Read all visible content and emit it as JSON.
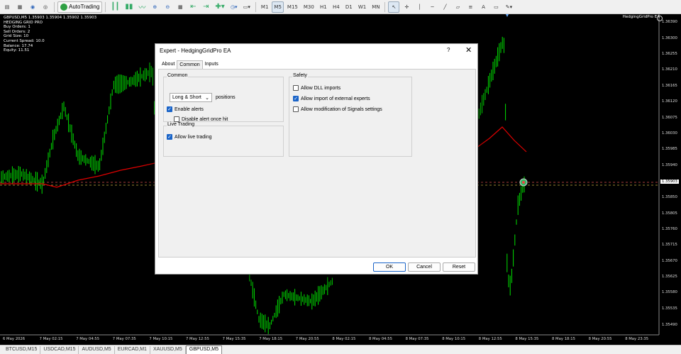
{
  "toolbar": {
    "autotrading_label": "AutoTrading",
    "timeframes": [
      "M1",
      "M5",
      "M15",
      "M30",
      "H1",
      "H4",
      "D1",
      "W1",
      "MN"
    ],
    "active_timeframe": "M5"
  },
  "chart": {
    "header": "GBPUSD,M5  1.35903 1.35904 1.35902 1.35903",
    "ea_name": "HedgingGridPro EA",
    "info_lines": [
      "HEDGING GRID PRO",
      "Buy Orders: 1",
      "Sell Orders: 2",
      "Grid Size: 10",
      "Current Spread: 10.0",
      "Balance: 17.74",
      "Equity: 11.51"
    ],
    "current_price": "1.35903",
    "price_labels": [
      "1.36390",
      "1.36300",
      "1.36255",
      "1.36210",
      "1.36165",
      "1.36120",
      "1.36075",
      "1.36030",
      "1.35985",
      "1.35940",
      "1.35850",
      "1.35805",
      "1.35760",
      "1.35715",
      "1.35670",
      "1.35625",
      "1.35580",
      "1.35535",
      "1.35490"
    ],
    "time_labels": [
      "6 May 2026",
      "7 May 02:15",
      "7 May 04:55",
      "7 May 07:35",
      "7 May 10:15",
      "7 May 12:55",
      "7 May 15:35",
      "7 May 18:15",
      "7 May 20:55",
      "8 May 02:15",
      "8 May 04:55",
      "8 May 07:35",
      "8 May 10:15",
      "8 May 12:55",
      "8 May 15:35",
      "8 May 18:15",
      "8 May 20:55",
      "8 May 23:35"
    ],
    "colors": {
      "candle": "#00e000",
      "ma": "#e00000",
      "level": "#e05050"
    }
  },
  "tabs": [
    "BTCUSD,M15",
    "USDCAD,M15",
    "AUDUSD,M5",
    "EURCAD,M1",
    "XAUUSD,M5",
    "GBPUSD,M5"
  ],
  "active_tab": "GBPUSD,M5",
  "dialog": {
    "title": "Expert - HedgingGridPro EA",
    "help": "?",
    "close": "✕",
    "tabs": [
      "About",
      "Common",
      "Inputs"
    ],
    "active_tab": "Common",
    "common": {
      "title": "Common",
      "positions_value": "Long & Short",
      "positions_label": "positions",
      "enable_alerts": {
        "label": "Enable alerts",
        "checked": true
      },
      "disable_alert_once": {
        "label": "Disable alert once hit",
        "checked": false
      }
    },
    "live_trading": {
      "title": "Live Trading",
      "allow_live": {
        "label": "Allow live trading",
        "checked": true
      }
    },
    "safety": {
      "title": "Safety",
      "dll": {
        "label": "Allow DLL imports",
        "checked": false
      },
      "external": {
        "label": "Allow import of external experts",
        "checked": true
      },
      "signals": {
        "label": "Allow modification of Signals settings",
        "checked": false
      }
    },
    "buttons": {
      "ok": "OK",
      "cancel": "Cancel",
      "reset": "Reset"
    }
  }
}
